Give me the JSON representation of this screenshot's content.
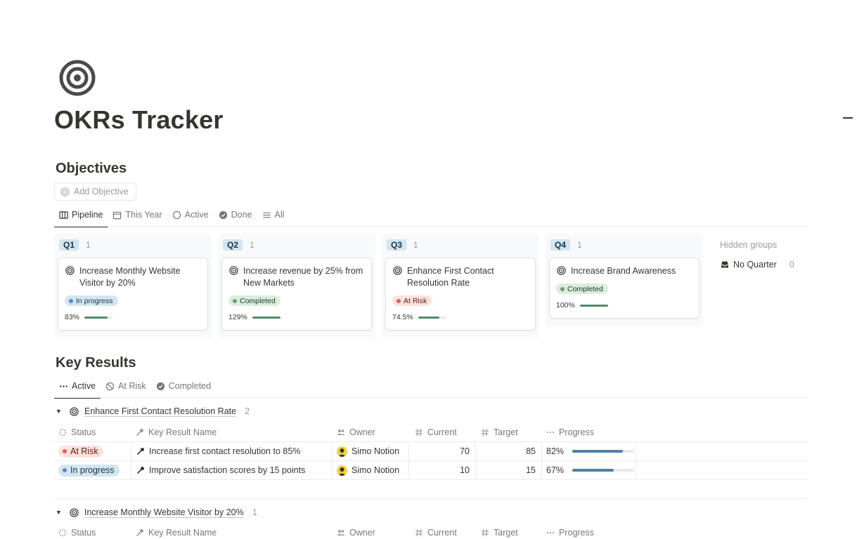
{
  "page": {
    "title": "OKRs Tracker",
    "icon": "target-icon"
  },
  "objectives": {
    "title": "Objectives",
    "add_button": "Add Objective",
    "tabs": [
      {
        "label": "Pipeline",
        "icon": "board-icon",
        "active": true
      },
      {
        "label": "This Year",
        "icon": "calendar-icon",
        "active": false
      },
      {
        "label": "Active",
        "icon": "circle-icon",
        "active": false
      },
      {
        "label": "Done",
        "icon": "check-circle-icon",
        "active": false
      },
      {
        "label": "All",
        "icon": "list-icon",
        "active": false
      }
    ],
    "columns": [
      {
        "label": "Q1",
        "count": "1",
        "card": {
          "title": "Increase Monthly Website Visitor by 20%",
          "status": "In progress",
          "progress_label": "83%",
          "progress": 0.83
        }
      },
      {
        "label": "Q2",
        "count": "1",
        "card": {
          "title": "Increase revenue by 25% from New Markets",
          "status": "Completed",
          "progress_label": "129%",
          "progress": 1.0
        }
      },
      {
        "label": "Q3",
        "count": "1",
        "card": {
          "title": "Enhance First Contact Resolution Rate",
          "status": "At Risk",
          "progress_label": "74.5%",
          "progress": 0.745
        }
      },
      {
        "label": "Q4",
        "count": "1",
        "card": {
          "title": "Increase Brand Awareness",
          "status": "Completed",
          "progress_label": "100%",
          "progress": 1.0
        }
      }
    ],
    "hidden_groups_label": "Hidden groups",
    "no_quarter": {
      "label": "No Quarter",
      "count": "0"
    }
  },
  "key_results": {
    "title": "Key Results",
    "tabs": [
      {
        "label": "Active",
        "icon": "dots-icon",
        "active": true
      },
      {
        "label": "At Risk",
        "icon": "prohibited-icon",
        "active": false
      },
      {
        "label": "Completed",
        "icon": "check-circle-icon",
        "active": false
      }
    ],
    "columns": {
      "status": "Status",
      "name": "Key Result Name",
      "owner": "Owner",
      "current": "Current",
      "target": "Target",
      "progress": "Progress"
    },
    "groups": [
      {
        "name": "Enhance First Contact Resolution Rate",
        "count": "2",
        "rows": [
          {
            "status": "At Risk",
            "name": "Increase first contact resolution to 85%",
            "owner": "Simo Notion",
            "current": "70",
            "target": "85",
            "progress_label": "82%",
            "progress": 0.82
          },
          {
            "status": "In progress",
            "name": "Improve satisfaction scores by 15 points",
            "owner": "Simo Notion",
            "current": "10",
            "target": "15",
            "progress_label": "67%",
            "progress": 0.67
          }
        ]
      },
      {
        "name": "Increase Monthly Website Visitor by 20%",
        "count": "1",
        "rows": []
      }
    ]
  },
  "colors": {
    "text": "#37352f",
    "muted": "#9b9a97",
    "in_progress_bg": "#d3e5ef",
    "completed_bg": "#dbeddb",
    "at_risk_bg": "#ffe2dd",
    "progress_green": "#4f8a6b",
    "progress_blue": "#4f7fa8"
  }
}
